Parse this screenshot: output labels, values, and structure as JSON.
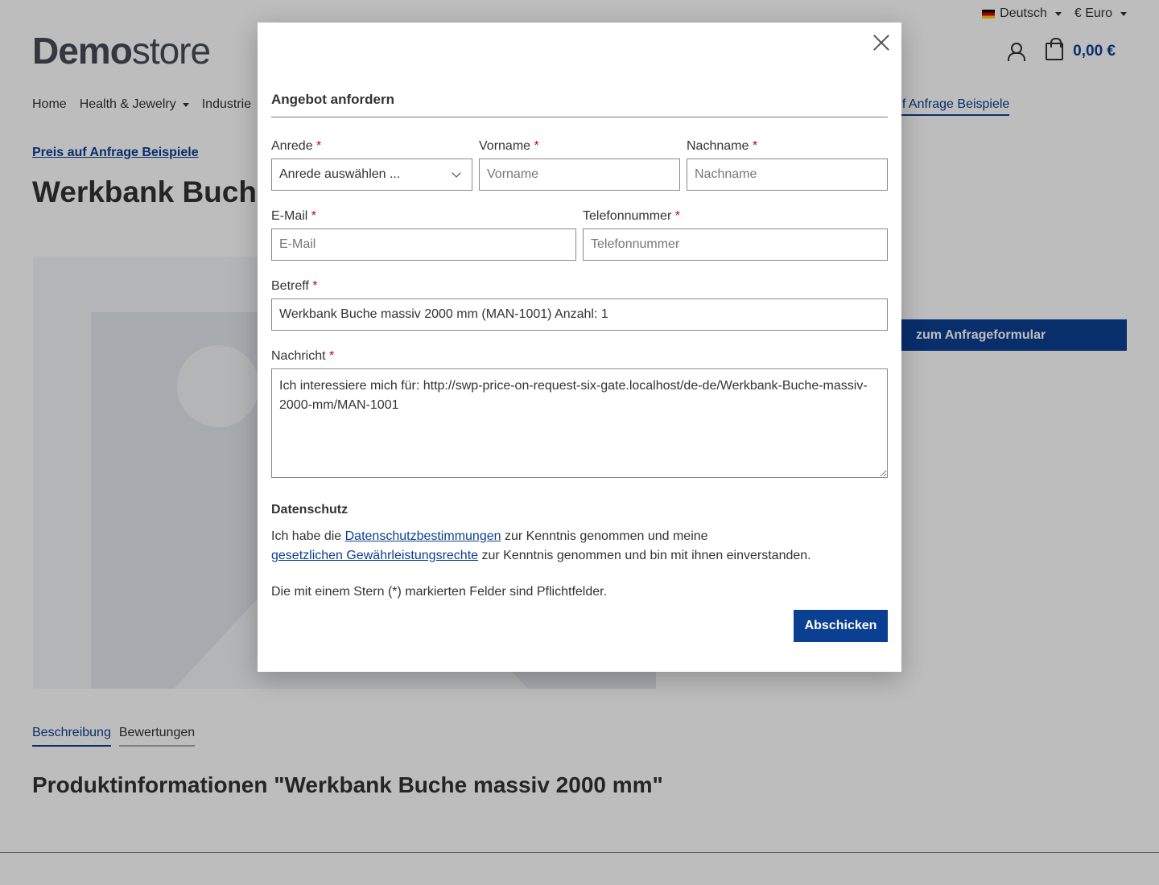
{
  "topbar": {
    "language": "Deutsch",
    "currency": "€ Euro"
  },
  "logo": {
    "bold": "Demo",
    "light": "store"
  },
  "header": {
    "cart_total": "0,00 €"
  },
  "nav": {
    "items": [
      "Home",
      "Health & Jewelry",
      "Industrie"
    ],
    "active": "uf Anfrage Beispiele"
  },
  "breadcrumb": "Preis auf Anfrage Beispiele",
  "product": {
    "title": "Werkbank Buch"
  },
  "cta": {
    "label": "zum Anfrageformular"
  },
  "tabs": [
    "Beschreibung",
    "Bewertungen"
  ],
  "section_title": "Produktinformationen \"Werkbank Buche massiv 2000 mm\"",
  "modal": {
    "title": "Angebot anfordern",
    "fields": {
      "anrede": {
        "label": "Anrede",
        "value": "Anrede auswählen ..."
      },
      "vorname": {
        "label": "Vorname",
        "placeholder": "Vorname"
      },
      "nachname": {
        "label": "Nachname",
        "placeholder": "Nachname"
      },
      "email": {
        "label": "E-Mail",
        "placeholder": "E-Mail"
      },
      "telefon": {
        "label": "Telefonnummer",
        "placeholder": "Telefonnummer"
      },
      "betreff": {
        "label": "Betreff",
        "value": "Werkbank Buche massiv 2000 mm (MAN-1001) Anzahl: 1"
      },
      "nachricht": {
        "label": "Nachricht",
        "value": "Ich interessiere mich für: http://swp-price-on-request-six-gate.localhost/de-de/Werkbank-Buche-massiv-2000-mm/MAN-1001"
      }
    },
    "required_marker": "*",
    "privacy": {
      "title": "Datenschutz",
      "text1": "Ich habe die ",
      "link1": "Datenschutzbestimmungen",
      "text2": " zur Kenntnis genommen und meine ",
      "link2": "gesetzlichen Gewährleistungsrechte",
      "text3": " zur Kenntnis genommen und bin mit ihnen einverstanden."
    },
    "required_note": "Die mit einem Stern (*) markierten Felder sind Pflichtfelder.",
    "submit_label": "Abschicken"
  },
  "colors": {
    "primary": "#0b3f91",
    "required": "#c2001b"
  },
  "icons": [
    "flag-de-icon",
    "chevron-down-icon",
    "user-icon",
    "shopping-bag-icon",
    "close-icon",
    "image-placeholder-icon"
  ]
}
